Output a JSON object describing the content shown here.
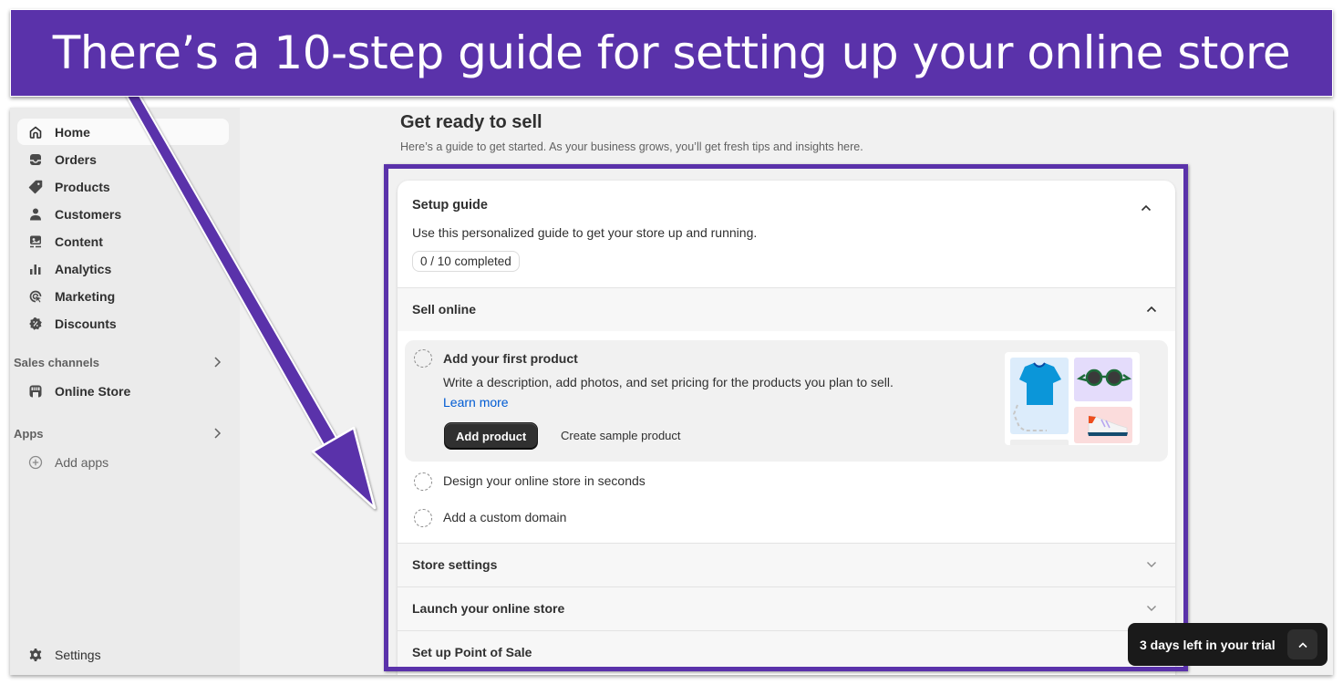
{
  "annotation": {
    "banner_text": "There’s a 10-step guide for setting up your online store",
    "accent_color": "#5a32aa"
  },
  "sidebar": {
    "items": [
      {
        "label": "Home",
        "icon": "home-icon",
        "active": true
      },
      {
        "label": "Orders",
        "icon": "inbox-icon"
      },
      {
        "label": "Products",
        "icon": "tag-icon"
      },
      {
        "label": "Customers",
        "icon": "person-icon"
      },
      {
        "label": "Content",
        "icon": "content-icon"
      },
      {
        "label": "Analytics",
        "icon": "bar-chart-icon"
      },
      {
        "label": "Marketing",
        "icon": "target-icon"
      },
      {
        "label": "Discounts",
        "icon": "discount-icon"
      }
    ],
    "sales_channels": {
      "label": "Sales channels",
      "items": [
        {
          "label": "Online Store",
          "icon": "store-icon"
        }
      ]
    },
    "apps": {
      "label": "Apps",
      "items": [
        {
          "label": "Add apps",
          "icon": "plus-circle-icon"
        }
      ]
    },
    "settings": {
      "label": "Settings",
      "icon": "gear-icon"
    }
  },
  "main": {
    "title": "Get ready to sell",
    "subtitle": "Here’s a guide to get started. As your business grows, you’ll get fresh tips and insights here.",
    "setup_guide": {
      "title": "Setup guide",
      "description": "Use this personalized guide to get your store up and running.",
      "progress_label": "0 / 10 completed",
      "completed": 0,
      "total": 10,
      "groups": [
        {
          "title": "Sell online",
          "expanded": true,
          "tasks": [
            {
              "title": "Add your first product",
              "description": "Write a description, add photos, and set pricing for the products you plan to sell.",
              "link": "Learn more",
              "primary_action": "Add product",
              "secondary_action": "Create sample product",
              "expanded": true
            },
            {
              "title": "Design your online store in seconds"
            },
            {
              "title": "Add a custom domain"
            }
          ]
        },
        {
          "title": "Store settings",
          "expanded": false
        },
        {
          "title": "Launch your online store",
          "expanded": false
        },
        {
          "title": "Set up Point of Sale",
          "expanded": false
        }
      ]
    }
  },
  "trial": {
    "text": "3 days left in your trial"
  }
}
